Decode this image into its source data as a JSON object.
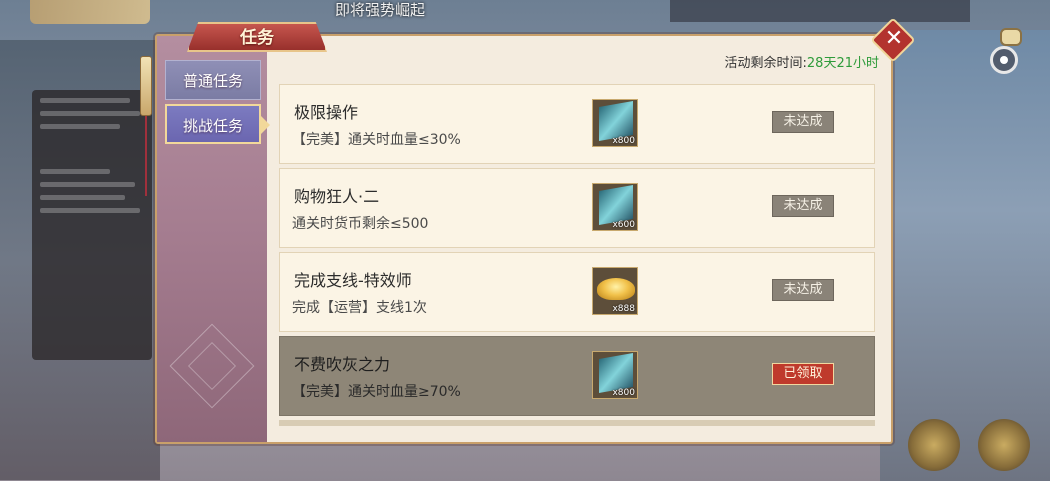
{
  "background": {
    "top_text": "即将强势崛起"
  },
  "dialog": {
    "title": "任务",
    "close_label": "✕",
    "time_label": "活动剩余时间:",
    "time_value": "28天21小时",
    "tabs": [
      {
        "label": "普通任务",
        "selected": false
      },
      {
        "label": "挑战任务",
        "selected": true
      }
    ],
    "tasks": [
      {
        "title": "极限操作",
        "desc": "【完美】通关时血量≤30%",
        "reward_icon": "card-icon",
        "reward_qty": "x800",
        "status": "未达成",
        "claimed": false
      },
      {
        "title": "购物狂人·二",
        "desc": "通关时货币剩余≤500",
        "reward_icon": "card-icon",
        "reward_qty": "x600",
        "status": "未达成",
        "claimed": false
      },
      {
        "title": "完成支线-特效师",
        "desc": "完成【运营】支线1次",
        "reward_icon": "gold-ingot-icon",
        "reward_qty": "x888",
        "status": "未达成",
        "claimed": false
      },
      {
        "title": "不费吹灰之力",
        "desc": "【完美】通关时血量≥70%",
        "reward_icon": "card-icon",
        "reward_qty": "x800",
        "status": "已领取",
        "claimed": true
      }
    ]
  },
  "colors": {
    "accent_green": "#2e9b3a",
    "claimed_red": "#bf3a2c",
    "title_red": "#98302c"
  }
}
